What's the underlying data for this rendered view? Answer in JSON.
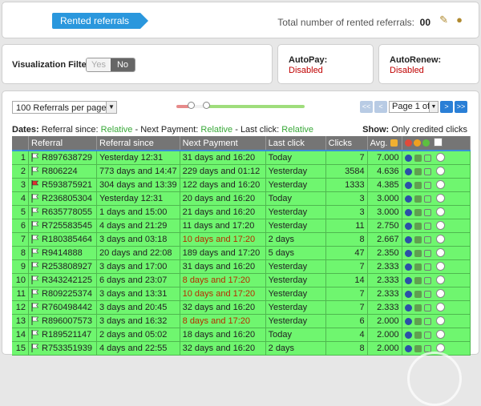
{
  "header": {
    "section_tag": "Rented referrals",
    "total_label": "Total number of rented referrals:",
    "total_count": "00"
  },
  "filter": {
    "label": "Visualization Filter:",
    "option_yes": "Yes",
    "option_no": "No",
    "selected": "No"
  },
  "autopay": {
    "label": "AutoPay:",
    "value": "Disabled"
  },
  "autorenew": {
    "label": "AutoRenew:",
    "value": "Disabled"
  },
  "toolbar": {
    "per_page": "100 Referrals per page",
    "page_label": "Page 1 of 4",
    "btn_first": "<<",
    "btn_prev": "<",
    "btn_next": ">",
    "btn_last": ">>"
  },
  "dates": {
    "label": "Dates:",
    "since_label": "Referral since:",
    "since_value": "Relative",
    "next_label": "Next Payment:",
    "next_value": "Relative",
    "last_label": "Last click:",
    "last_value": "Relative"
  },
  "show": {
    "label": "Show:",
    "value": "Only credited clicks"
  },
  "table": {
    "headers": [
      "Referral",
      "Referral since",
      "Next Payment",
      "Last click",
      "Clicks",
      "Avg."
    ],
    "rows": [
      {
        "n": "1",
        "id": "R897638729",
        "since": "Yesterday 12:31",
        "next": "31 days and 16:20",
        "last": "Today",
        "clicks": "7",
        "avg": "7.000",
        "flag": "green",
        "late": false
      },
      {
        "n": "2",
        "id": "R806224",
        "since": "773 days and 14:47",
        "next": "229 days and 01:12",
        "last": "Yesterday",
        "clicks": "3584",
        "avg": "4.636",
        "flag": "green",
        "late": false
      },
      {
        "n": "3",
        "id": "R593875921",
        "since": "304 days and 13:39",
        "next": "122 days and 16:20",
        "last": "Yesterday",
        "clicks": "1333",
        "avg": "4.385",
        "flag": "red",
        "late": false
      },
      {
        "n": "4",
        "id": "R236805304",
        "since": "Yesterday 12:31",
        "next": "20 days and 16:20",
        "last": "Today",
        "clicks": "3",
        "avg": "3.000",
        "flag": "green",
        "late": false
      },
      {
        "n": "5",
        "id": "R635778055",
        "since": "1 days and 15:00",
        "next": "21 days and 16:20",
        "last": "Yesterday",
        "clicks": "3",
        "avg": "3.000",
        "flag": "green",
        "late": false
      },
      {
        "n": "6",
        "id": "R725583545",
        "since": "4 days and 21:29",
        "next": "11 days and 17:20",
        "last": "Yesterday",
        "clicks": "11",
        "avg": "2.750",
        "flag": "green",
        "late": false
      },
      {
        "n": "7",
        "id": "R180385464",
        "since": "3 days and 03:18",
        "next": "10 days and 17:20",
        "last": "2 days",
        "clicks": "8",
        "avg": "2.667",
        "flag": "green",
        "late": true
      },
      {
        "n": "8",
        "id": "R9414888",
        "since": "20 days and 22:08",
        "next": "189 days and 17:20",
        "last": "5 days",
        "clicks": "47",
        "avg": "2.350",
        "flag": "green",
        "late": false
      },
      {
        "n": "9",
        "id": "R253808927",
        "since": "3 days and 17:00",
        "next": "31 days and 16:20",
        "last": "Yesterday",
        "clicks": "7",
        "avg": "2.333",
        "flag": "green",
        "late": false
      },
      {
        "n": "10",
        "id": "R343242125",
        "since": "6 days and 23:07",
        "next": "8 days and 17:20",
        "last": "Yesterday",
        "clicks": "14",
        "avg": "2.333",
        "flag": "green",
        "late": true
      },
      {
        "n": "11",
        "id": "R809225374",
        "since": "3 days and 13:31",
        "next": "10 days and 17:20",
        "last": "Yesterday",
        "clicks": "7",
        "avg": "2.333",
        "flag": "green",
        "late": true
      },
      {
        "n": "12",
        "id": "R760498442",
        "since": "3 days and 20:45",
        "next": "32 days and 16:20",
        "last": "Yesterday",
        "clicks": "7",
        "avg": "2.333",
        "flag": "green",
        "late": false
      },
      {
        "n": "13",
        "id": "R896007573",
        "since": "3 days and 16:32",
        "next": "8 days and 17:20",
        "last": "Yesterday",
        "clicks": "6",
        "avg": "2.000",
        "flag": "green",
        "late": true
      },
      {
        "n": "14",
        "id": "R189521147",
        "since": "2 days and 05:02",
        "next": "18 days and 16:20",
        "last": "Today",
        "clicks": "4",
        "avg": "2.000",
        "flag": "green",
        "late": false
      },
      {
        "n": "15",
        "id": "R753351939",
        "since": "4 days and 22:55",
        "next": "32 days and 16:20",
        "last": "2 days",
        "clicks": "8",
        "avg": "2.000",
        "flag": "green",
        "late": false
      }
    ]
  },
  "colors": {
    "row_bg": "#6ff66f",
    "header_bg": "#757575",
    "accent": "#2a97dd",
    "late": "#b82c00",
    "disabled": "#c00000"
  }
}
